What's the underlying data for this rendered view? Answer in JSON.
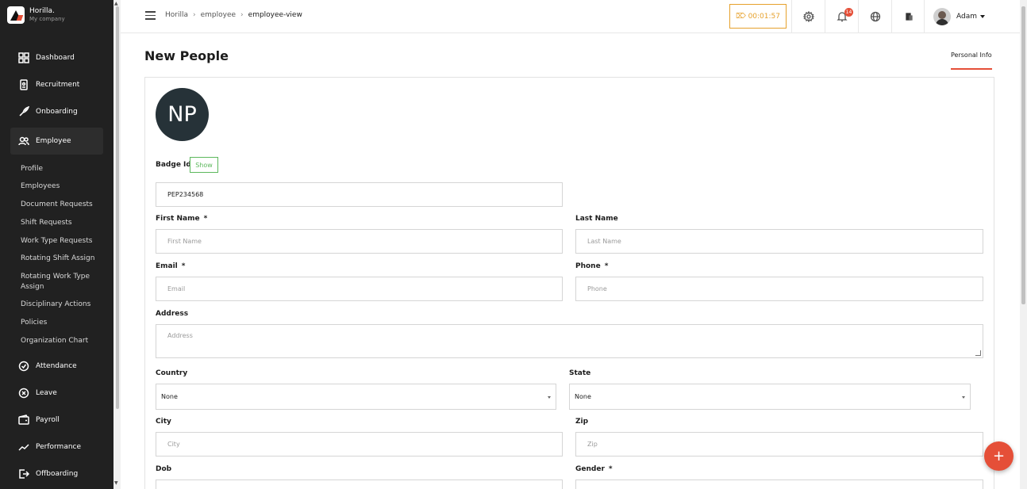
{
  "brand": {
    "name": "Horilla.",
    "company": "My company"
  },
  "sidebar": {
    "items": [
      {
        "label": "Dashboard",
        "icon": "dashboard-icon"
      },
      {
        "label": "Recruitment",
        "icon": "recruitment-icon"
      },
      {
        "label": "Onboarding",
        "icon": "rocket-icon"
      },
      {
        "label": "Employee",
        "icon": "people-icon",
        "active": true
      },
      {
        "label": "Attendance",
        "icon": "attendance-icon"
      },
      {
        "label": "Leave",
        "icon": "leave-icon"
      },
      {
        "label": "Payroll",
        "icon": "wallet-icon"
      },
      {
        "label": "Performance",
        "icon": "trend-icon"
      },
      {
        "label": "Offboarding",
        "icon": "exit-icon"
      }
    ],
    "subitems": [
      "Profile",
      "Employees",
      "Document Requests",
      "Shift Requests",
      "Work Type Requests",
      "Rotating Shift Assign",
      "Rotating Work Type Assign",
      "Disciplinary Actions",
      "Policies",
      "Organization Chart"
    ]
  },
  "header": {
    "breadcrumb": [
      "Horilla",
      "employee",
      "employee-view"
    ],
    "timer": "⌦ 00:01:57",
    "notification_count": "14",
    "user_name": "Adam"
  },
  "main": {
    "title": "New People",
    "tab": "Personal Info",
    "avatar_initials": "NP"
  },
  "form": {
    "badge_label": "Badge Id",
    "show_label": "Show",
    "badge_value": "PEP234568",
    "first_name_label": "First Name",
    "first_name_placeholder": "First Name",
    "last_name_label": "Last Name",
    "last_name_placeholder": "Last Name",
    "email_label": "Email",
    "email_placeholder": "Email",
    "phone_label": "Phone",
    "phone_placeholder": "Phone",
    "address_label": "Address",
    "address_placeholder": "Address",
    "country_label": "Country",
    "country_value": "None",
    "state_label": "State",
    "state_value": "None",
    "city_label": "City",
    "city_placeholder": "City",
    "zip_label": "Zip",
    "zip_placeholder": "Zip",
    "dob_label": "Dob",
    "gender_label": "Gender",
    "required_mark": "*"
  },
  "colors": {
    "accent": "#e54f38",
    "sidebar": "#212121",
    "timer": "#e6a12c",
    "show": "#5cb85c"
  }
}
